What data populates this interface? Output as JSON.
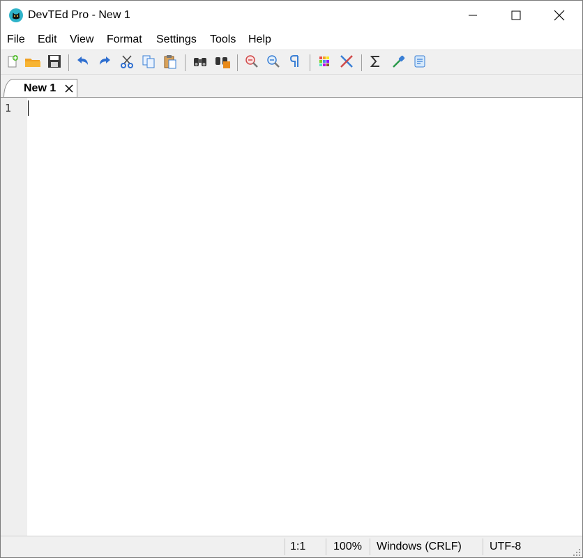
{
  "window": {
    "title": "DevTEd Pro - New 1",
    "app_icon": "cat-icon",
    "controls": [
      "minimize-icon",
      "maximize-icon",
      "close-icon"
    ]
  },
  "menu": {
    "items": [
      "File",
      "Edit",
      "View",
      "Format",
      "Settings",
      "Tools",
      "Help"
    ]
  },
  "toolbar": {
    "buttons": [
      "new-document-icon",
      "open-folder-icon",
      "save-icon",
      "undo-icon",
      "redo-icon",
      "cut-icon",
      "copy-icon",
      "paste-icon",
      "find-icon",
      "replace-icon",
      "zoom-in-icon",
      "zoom-out-icon",
      "show-all-characters-icon",
      "color-palette-icon",
      "tools-icon",
      "sigma-icon",
      "color-picker-icon",
      "script-icon"
    ]
  },
  "tabs": [
    {
      "label": "New 1",
      "active": true
    }
  ],
  "editor": {
    "lines": [
      "1"
    ]
  },
  "status": {
    "position": "1:1",
    "zoom": "100%",
    "line_ending": "Windows (CRLF)",
    "encoding": "UTF-8"
  },
  "colors": {
    "accent": "#2aa3c4",
    "toolbar_blue": "#3a7fd5",
    "toolbar_orange": "#e88a1a"
  }
}
